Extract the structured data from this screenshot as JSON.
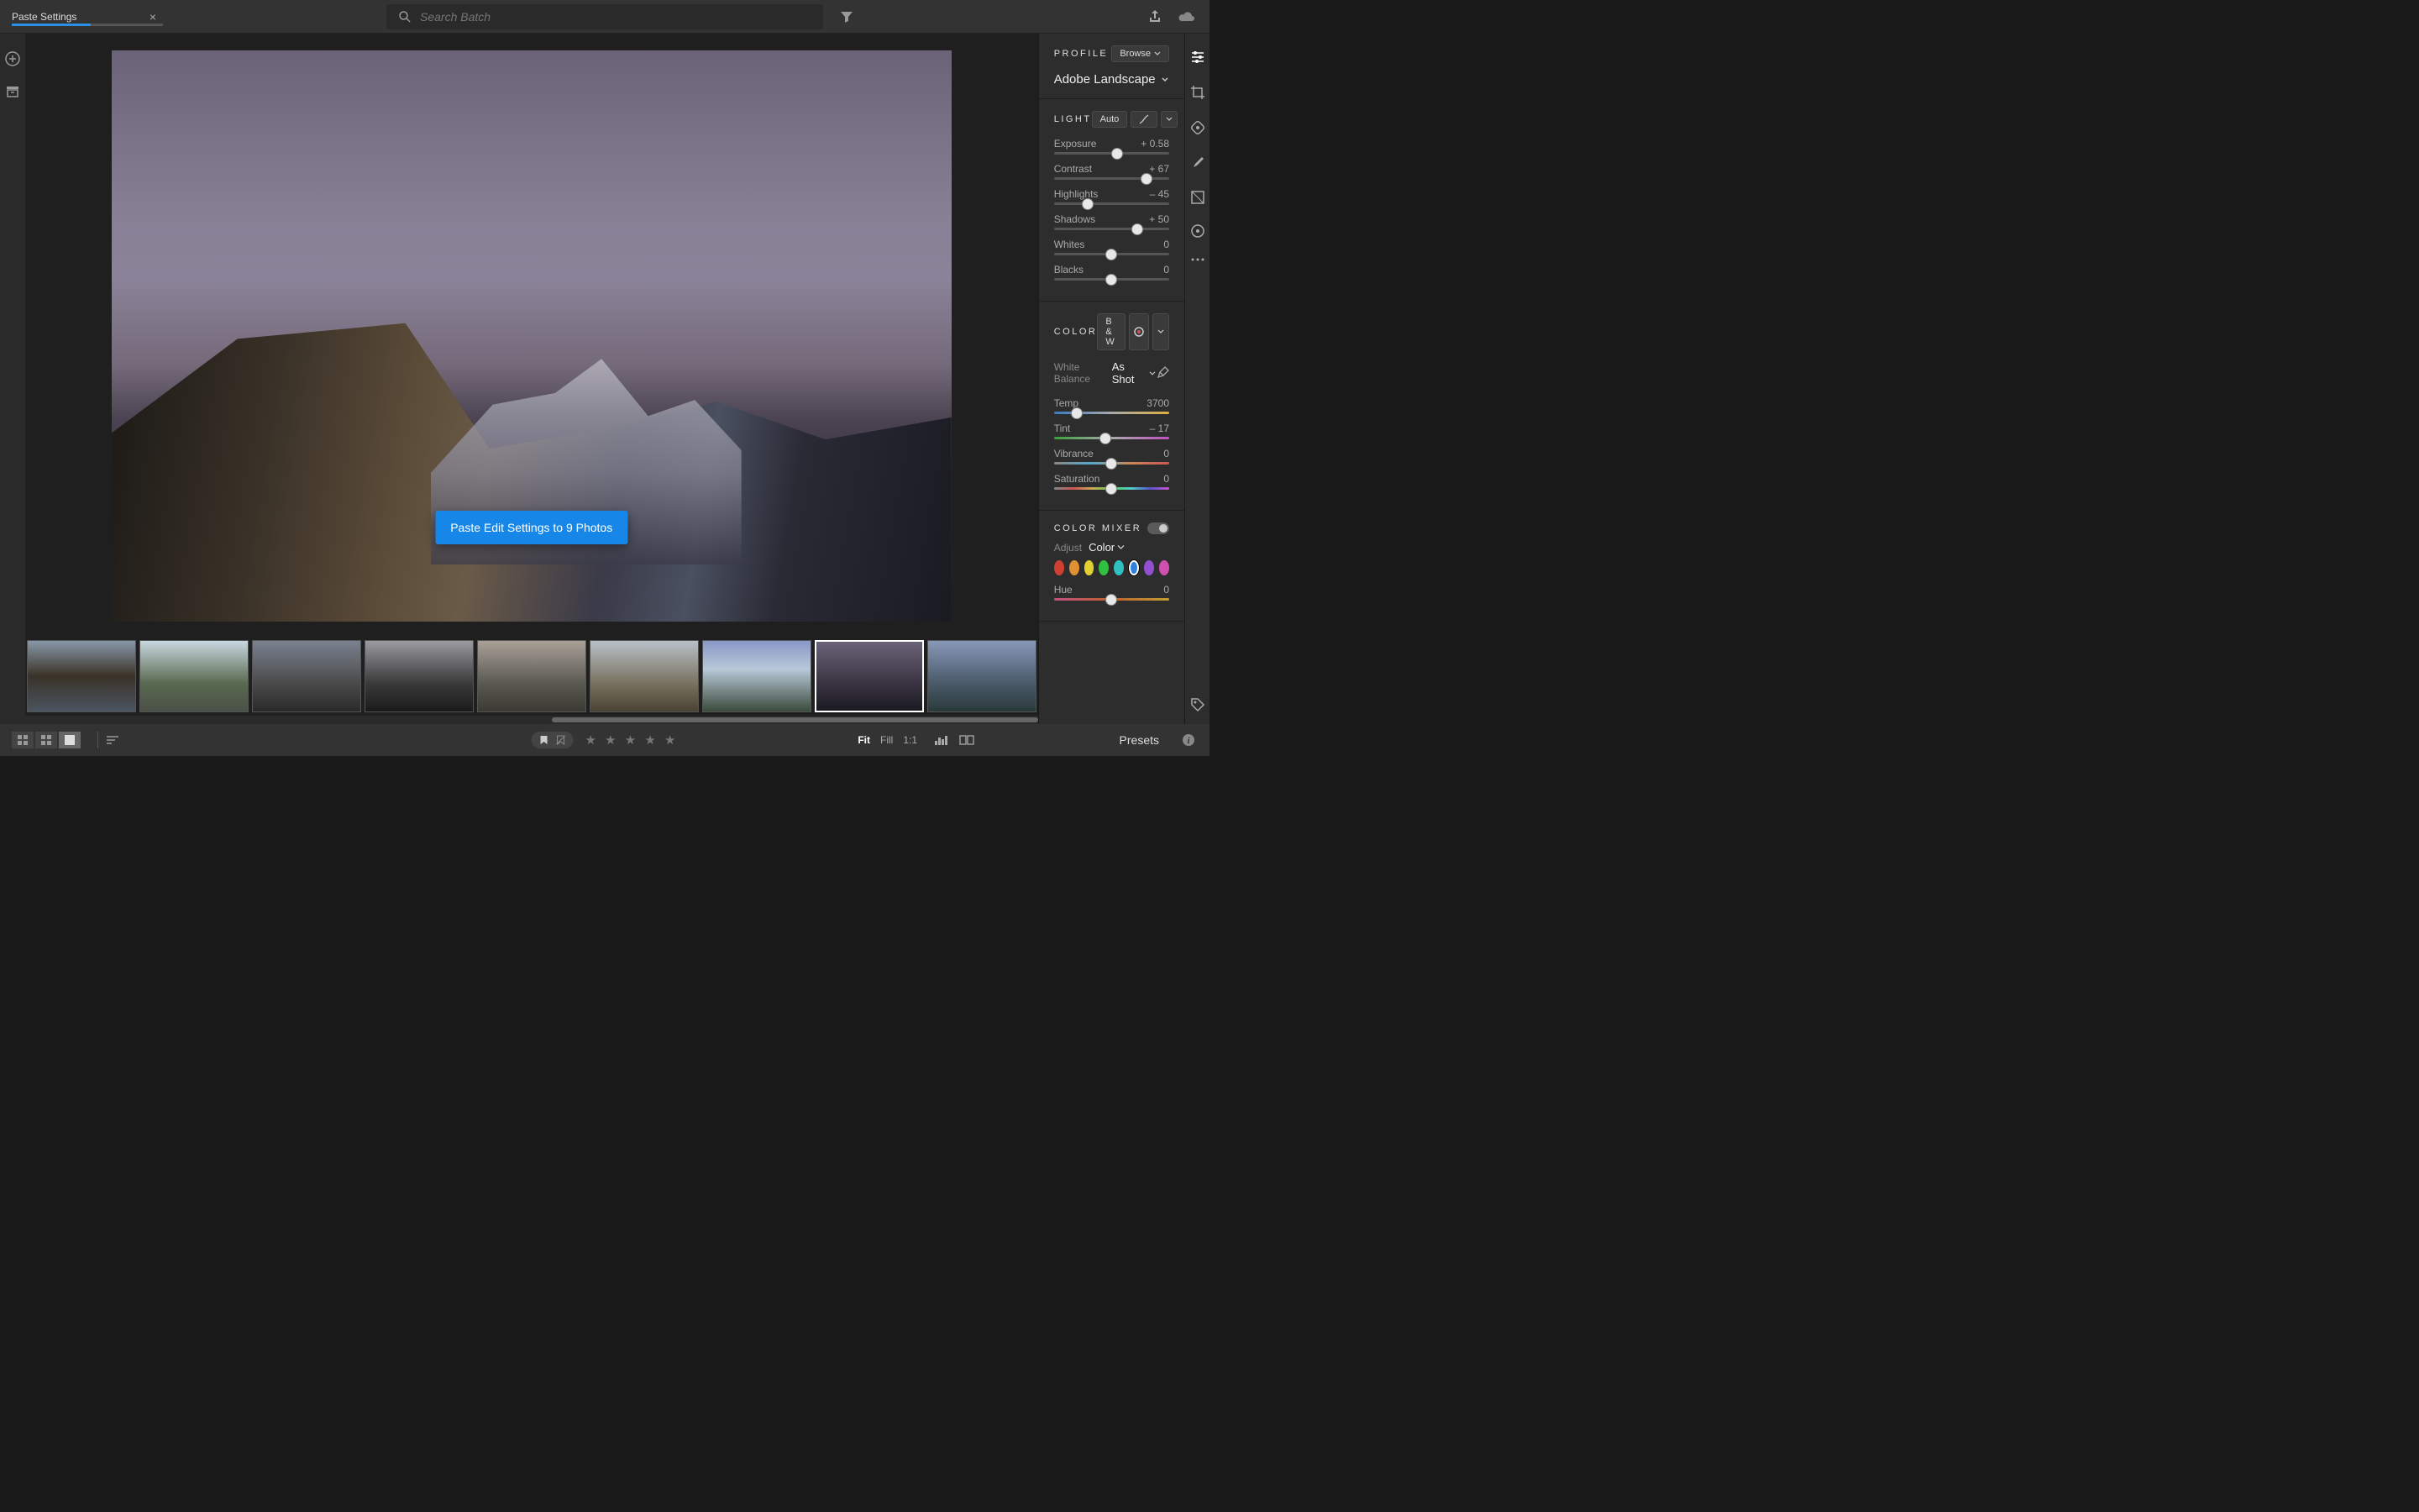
{
  "tab": {
    "title": "Paste Settings"
  },
  "search": {
    "placeholder": "Search Batch"
  },
  "toast": "Paste Edit Settings to 9 Photos",
  "profile": {
    "label": "PROFILE",
    "browse": "Browse",
    "name": "Adobe Landscape"
  },
  "light": {
    "label": "LIGHT",
    "auto": "Auto",
    "sliders": [
      {
        "name": "Exposure",
        "value": "+ 0.58",
        "pos": 55
      },
      {
        "name": "Contrast",
        "value": "+ 67",
        "pos": 80
      },
      {
        "name": "Highlights",
        "value": "– 45",
        "pos": 29
      },
      {
        "name": "Shadows",
        "value": "+ 50",
        "pos": 72
      },
      {
        "name": "Whites",
        "value": "0",
        "pos": 50
      },
      {
        "name": "Blacks",
        "value": "0",
        "pos": 50
      }
    ]
  },
  "color": {
    "label": "COLOR",
    "bw": "B & W",
    "whitebalance_label": "White Balance",
    "whitebalance_value": "As Shot",
    "sliders": [
      {
        "name": "Temp",
        "value": "3700",
        "pos": 20,
        "cls": "temp"
      },
      {
        "name": "Tint",
        "value": "– 17",
        "pos": 45,
        "cls": "tint"
      },
      {
        "name": "Vibrance",
        "value": "0",
        "pos": 50,
        "cls": "vibrance"
      },
      {
        "name": "Saturation",
        "value": "0",
        "pos": 50,
        "cls": "saturation"
      }
    ]
  },
  "mixer": {
    "label": "COLOR MIXER",
    "adjust_label": "Adjust",
    "adjust_value": "Color",
    "swatches": [
      "#d04030",
      "#e09030",
      "#e0d030",
      "#30c040",
      "#30c0c0",
      "#3080e0",
      "#9050d0",
      "#d050b0"
    ],
    "selected_swatch": 5,
    "hue": {
      "name": "Hue",
      "value": "0",
      "pos": 50
    }
  },
  "zoom": {
    "fit": "Fit",
    "fill": "Fill",
    "oneone": "1:1"
  },
  "presets": "Presets"
}
